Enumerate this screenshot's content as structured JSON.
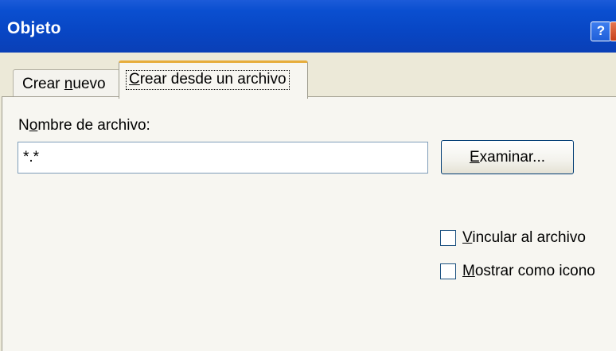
{
  "dialog": {
    "title": "Objeto",
    "help_glyph": "?",
    "close_glyph": "X"
  },
  "tabs": {
    "create_new": {
      "label_before": "Crear ",
      "label_underline": "n",
      "label_after": "uevo"
    },
    "create_from_file": {
      "label_underline": "C",
      "label_after": "rear desde un archivo",
      "selected": true
    }
  },
  "form": {
    "filename_label_before": "N",
    "filename_label_underline": "o",
    "filename_label_after": "mbre de archivo:",
    "filename_value": "*.*",
    "browse_label_underline": "E",
    "browse_label_after": "xaminar...",
    "link_label_underline": "V",
    "link_label_after": "incular al archivo",
    "link_checked": false,
    "icon_label_underline": "M",
    "icon_label_after": "ostrar como icono",
    "icon_checked": false
  },
  "icons": [
    "help-icon",
    "close-icon"
  ]
}
